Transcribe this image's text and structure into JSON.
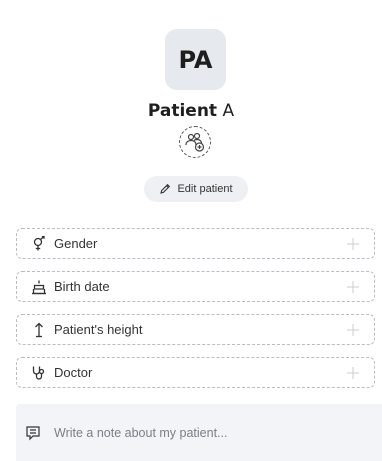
{
  "patient": {
    "initials": "PA",
    "name_bold": "Patient",
    "name_rest": " A"
  },
  "actions": {
    "edit_label": "Edit patient"
  },
  "fields": [
    {
      "label": "Gender",
      "icon": "gender-icon"
    },
    {
      "label": "Birth date",
      "icon": "cake-icon"
    },
    {
      "label": "Patient's height",
      "icon": "height-arrow-icon"
    },
    {
      "label": "Doctor",
      "icon": "stethoscope-icon"
    }
  ],
  "note": {
    "placeholder": "Write a note about my patient...",
    "icon": "note-icon"
  },
  "colors": {
    "avatar_bg": "#e6e9ee",
    "button_bg": "#eef0f3",
    "field_border": "#b8bcc4",
    "note_bg": "#f2f4f7"
  }
}
